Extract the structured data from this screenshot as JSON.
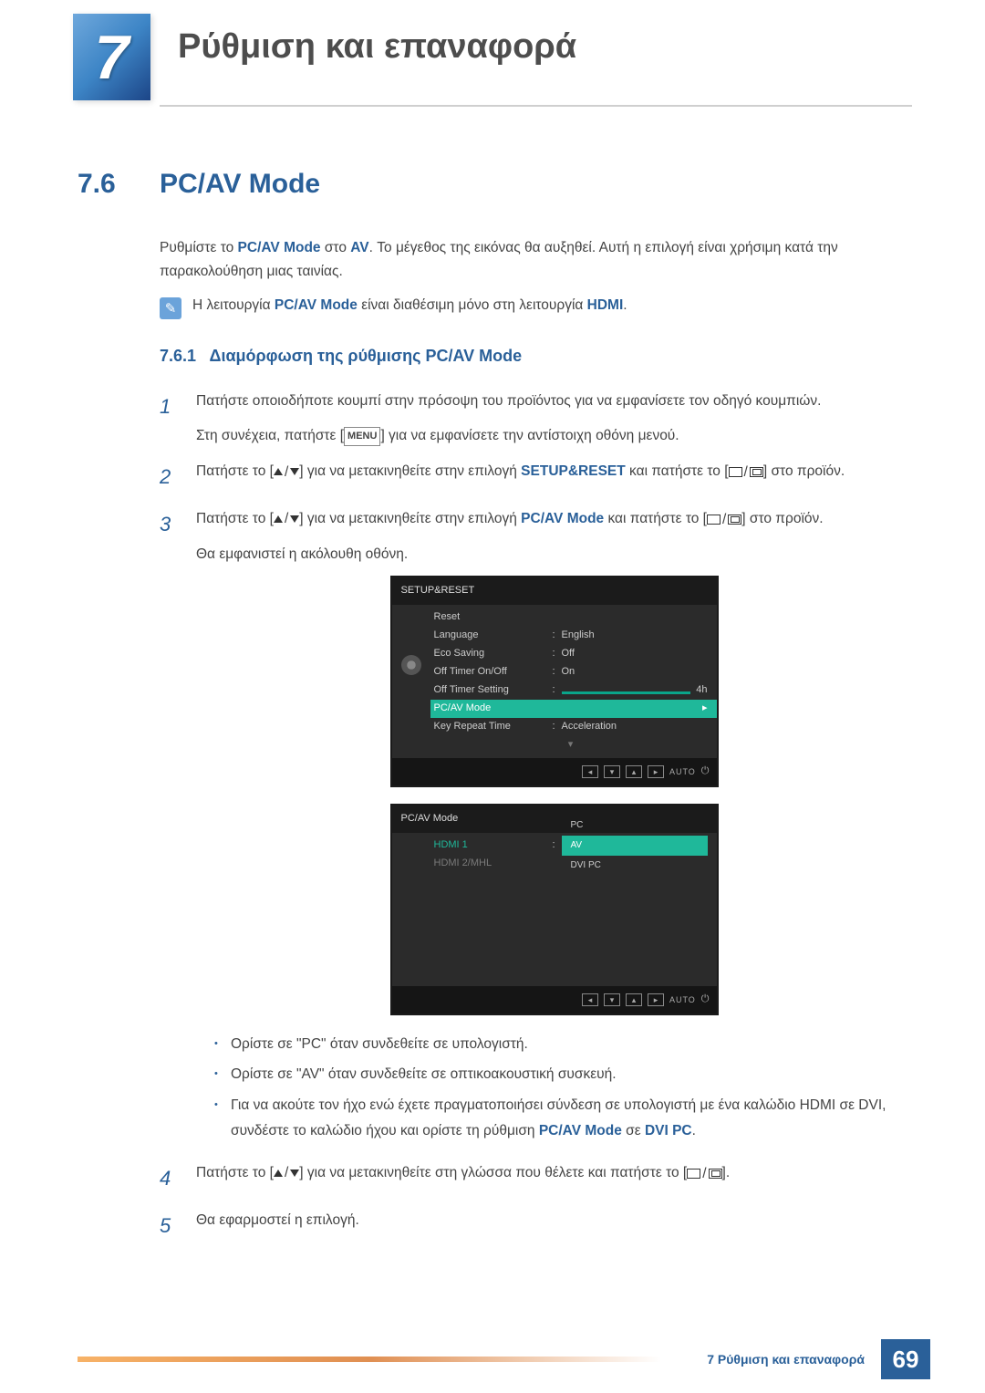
{
  "chapter": {
    "number": "7",
    "title": "Ρύθμιση και επαναφορά"
  },
  "section": {
    "number": "7.6",
    "title": "PC/AV Mode",
    "intro_1a": "Ρυθμίστε το ",
    "intro_1b": "PC/AV Mode",
    "intro_1c": " στο ",
    "intro_1d": "AV",
    "intro_1e": ". Το μέγεθος της εικόνας θα αυξηθεί. Αυτή η επιλογή είναι χρήσιμη κατά την παρακολούθηση μιας ταινίας.",
    "note_a": "Η λειτουργία ",
    "note_b": "PC/AV Mode",
    "note_c": " είναι διαθέσιμη μόνο στη λειτουργία ",
    "note_d": "HDMI",
    "note_e": "."
  },
  "subsection": {
    "number": "7.6.1",
    "title": "Διαμόρφωση της ρύθμισης PC/AV Mode"
  },
  "steps": {
    "s1": {
      "num": "1",
      "t1": "Πατήστε οποιοδήποτε κουμπί στην πρόσοψη του προϊόντος για να εμφανίσετε τον οδηγό κουμπιών.",
      "t2a": "Στη συνέχεια, πατήστε [",
      "t2b": "MENU",
      "t2c": "] για να εμφανίσετε την αντίστοιχη οθόνη μενού."
    },
    "s2": {
      "num": "2",
      "t_a": "Πατήστε το [",
      "t_b": "] για να μετακινηθείτε στην επιλογή ",
      "t_c": "SETUP&RESET",
      "t_d": " και πατήστε το [",
      "t_e": "] στο προϊόν."
    },
    "s3": {
      "num": "3",
      "t_a": "Πατήστε το [",
      "t_b": "] για να μετακινηθείτε στην επιλογή ",
      "t_c": "PC/AV Mode",
      "t_d": " και πατήστε το [",
      "t_e": "] στο προϊόν.",
      "t2": "Θα εμφανιστεί η ακόλουθη οθόνη."
    },
    "s4": {
      "num": "4",
      "t_a": "Πατήστε το [",
      "t_b": "] για να μετακινηθείτε στη γλώσσα που θέλετε και πατήστε το [",
      "t_c": "]."
    },
    "s5": {
      "num": "5",
      "t": "Θα εφαρμοστεί η επιλογή."
    }
  },
  "osd1": {
    "header": "SETUP&RESET",
    "rows": {
      "reset": "Reset",
      "language": "Language",
      "language_val": "English",
      "eco": "Eco Saving",
      "eco_val": "Off",
      "timer_onoff": "Off Timer On/Off",
      "timer_onoff_val": "On",
      "timer_setting": "Off Timer Setting",
      "timer_setting_val": "4h",
      "pcav": "PC/AV Mode",
      "keyrepeat": "Key Repeat Time",
      "keyrepeat_val": "Acceleration"
    },
    "footer_auto": "AUTO"
  },
  "osd2": {
    "header": "PC/AV Mode",
    "hdmi1": "HDMI 1",
    "hdmi2": "HDMI 2/MHL",
    "opt_pc": "PC",
    "opt_av": "AV",
    "opt_dvipc": "DVI PC",
    "footer_auto": "AUTO"
  },
  "bullets": {
    "b1": "Ορίστε σε \"PC\" όταν συνδεθείτε σε υπολογιστή.",
    "b2": "Ορίστε σε \"AV\" όταν συνδεθείτε σε οπτικοακουστική συσκευή.",
    "b3a": "Για να ακούτε τον ήχο ενώ έχετε πραγματοποιήσει σύνδεση σε υπολογιστή με ένα καλώδιο HDMI σε DVI, συνδέστε το καλώδιο ήχου και ορίστε τη ρύθμιση ",
    "b3b": "PC/AV Mode",
    "b3c": " σε ",
    "b3d": "DVI PC",
    "b3e": "."
  },
  "footer": {
    "chapter_label": "7 Ρύθμιση και επαναφορά",
    "page_number": "69"
  }
}
